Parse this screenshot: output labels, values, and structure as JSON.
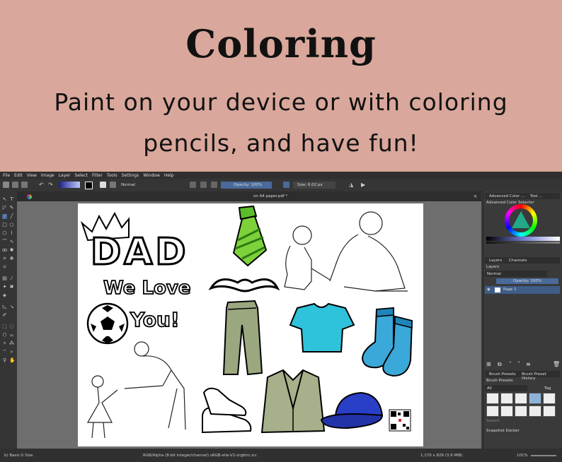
{
  "banner": {
    "title": "Coloring",
    "subtitle_line1": "Paint on your device or with coloring",
    "subtitle_line2": "pencils, and have fun!"
  },
  "menu": [
    "File",
    "Edit",
    "View",
    "Image",
    "Layer",
    "Select",
    "Filter",
    "Tools",
    "Settings",
    "Window",
    "Help"
  ],
  "toolbar": {
    "blend_mode": "Normal",
    "opacity": "Opacity: 100%",
    "size": "Size: 6.02 px"
  },
  "document": {
    "tab_name": "on A4 paper.pdf *"
  },
  "artwork": {
    "dad": "DAD",
    "we_love": "We Love",
    "you": "You!"
  },
  "dock": {
    "tab_advanced_color": "Advanced Color ...",
    "tab_tool": "Tool ...",
    "advanced_color_selector": "Advanced Color Selector",
    "tab_layers": "Layers",
    "tab_channels": "Channels",
    "layers_label": "Layers",
    "layer_blend": "Normal",
    "layer_opacity": "Opacity: 100%",
    "layer_name": "Page 1",
    "tab_brush_presets": "Brush Presets",
    "tab_brush_history": "Brush Preset History",
    "brush_presets_label": "Brush Presets",
    "brush_filter": "All",
    "brush_tag": "Tag",
    "search": "Search",
    "snapshot": "Snapshot Docker"
  },
  "status": {
    "brush": "b) Basic-5 Size",
    "color_space": "RGB/Alpha (8-bit integer/channel)  sRGB-elle-V2-srgbtrc.icc",
    "dimensions": "1,170 x 828 (3.9 MiB)",
    "zoom": "101%"
  },
  "colors": {
    "banner_bg": "#d9a79b",
    "app_bg": "#3b3b3b",
    "accent": "#4a6a9a",
    "tie": "#7dd23a",
    "tshirt": "#2ec3db",
    "socks": "#3aa8d8",
    "pants": "#9aa77f",
    "jacket": "#a6b08a",
    "cap": "#2a3fc8"
  }
}
